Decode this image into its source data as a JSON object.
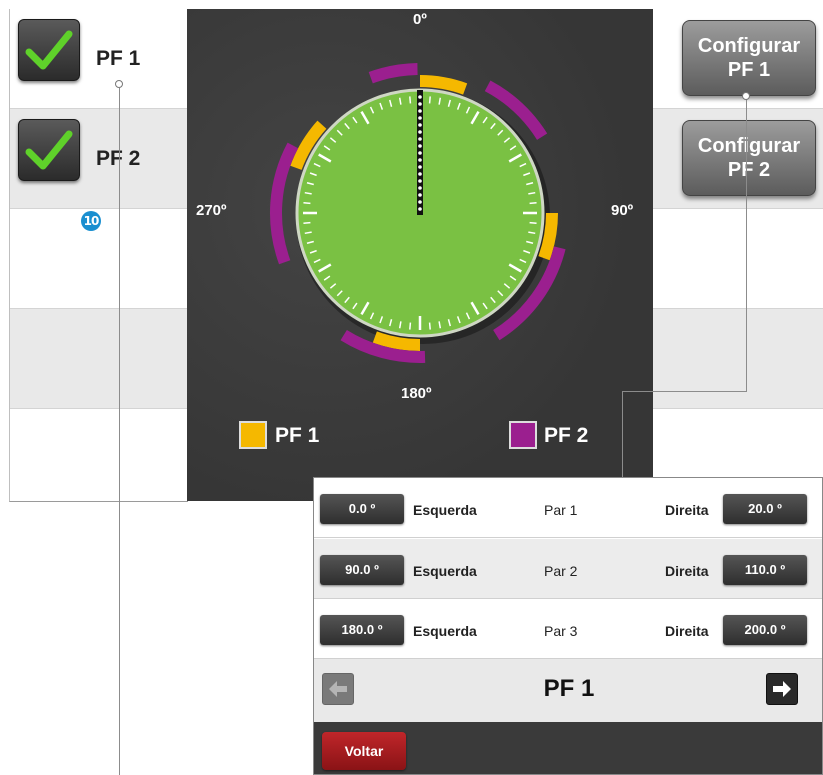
{
  "left_list": {
    "items": [
      {
        "label": "PF 1",
        "checked": true
      },
      {
        "label": "PF 2",
        "checked": true
      }
    ],
    "badge": "10"
  },
  "dial": {
    "deg_0": "0º",
    "deg_90": "90º",
    "deg_180": "180º",
    "deg_270": "270º",
    "legend": [
      {
        "label": "PF 1",
        "color": "#f5b800"
      },
      {
        "label": "PF 2",
        "color": "#9b1f8f"
      }
    ],
    "dial_color": "#7ac143"
  },
  "config_buttons": [
    {
      "label": "Configurar\nPF 1"
    },
    {
      "label": "Configurar\nPF 2"
    }
  ],
  "popup": {
    "rows": [
      {
        "left_value": "0.0 º",
        "left_label": "Esquerda",
        "pair": "Par 1",
        "right_label": "Direita",
        "right_value": "20.0 º"
      },
      {
        "left_value": "90.0 º",
        "left_label": "Esquerda",
        "pair": "Par 2",
        "right_label": "Direita",
        "right_value": "110.0 º"
      },
      {
        "left_value": "180.0 º",
        "left_label": "Esquerda",
        "pair": "Par 3",
        "right_label": "Direita",
        "right_value": "200.0 º"
      }
    ],
    "title": "PF 1",
    "back_label": "Voltar"
  }
}
